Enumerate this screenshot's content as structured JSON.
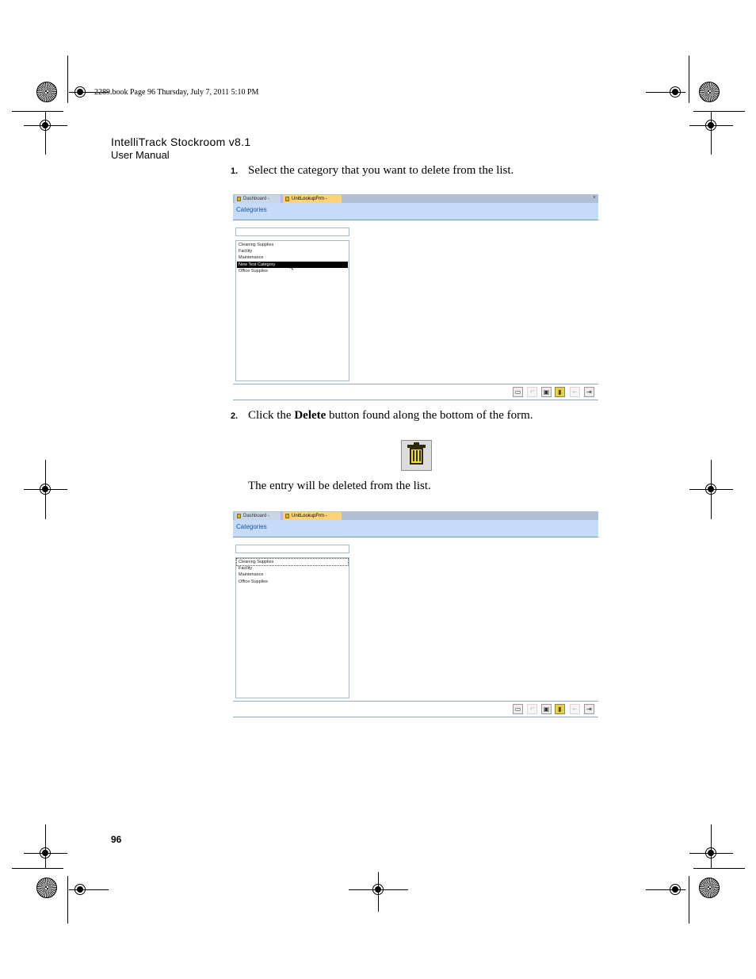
{
  "slug": "2289.book  Page 96  Thursday, July 7, 2011  5:10 PM",
  "header": {
    "title": "IntelliTrack Stockroom v8.1",
    "subtitle": "User Manual"
  },
  "steps": [
    {
      "num": "1.",
      "text": "Select the category that you want to delete from the list."
    },
    {
      "num": "2.",
      "text_before": "Click the ",
      "bold": "Delete",
      "text_after": " button found along the bottom of the form."
    }
  ],
  "result_text": "The entry will be deleted from the list.",
  "page_number": "96",
  "screenshot_before": {
    "tabs": [
      {
        "label": "Dashboard - DEMO",
        "active": false
      },
      {
        "label": "UnitLookupFrm - DEMO",
        "active": true
      }
    ],
    "form_title": "Categories",
    "items": [
      "Cleaning Supplies",
      "Facility",
      "Maintenance",
      "New Test Category",
      "Office Supplies"
    ],
    "selected_item": "New Test Category"
  },
  "screenshot_after": {
    "tabs": [
      {
        "label": "Dashboard - DEMO",
        "active": false
      },
      {
        "label": "UnitLookupFrm - DEMO",
        "active": true
      }
    ],
    "form_title": "Categories",
    "items": [
      "Cleaning Supplies",
      "Facility",
      "Maintenance",
      "Office Supplies"
    ]
  },
  "toolbar_icons": [
    "new-record-icon",
    "undo-icon",
    "save-icon",
    "delete-icon",
    "back-icon",
    "exit-icon"
  ],
  "icon_glyphs": {
    "new": "▭",
    "undo": "↶",
    "save": "▣",
    "delete": "▮",
    "back": "←",
    "exit": "⇥",
    "close": "×"
  }
}
